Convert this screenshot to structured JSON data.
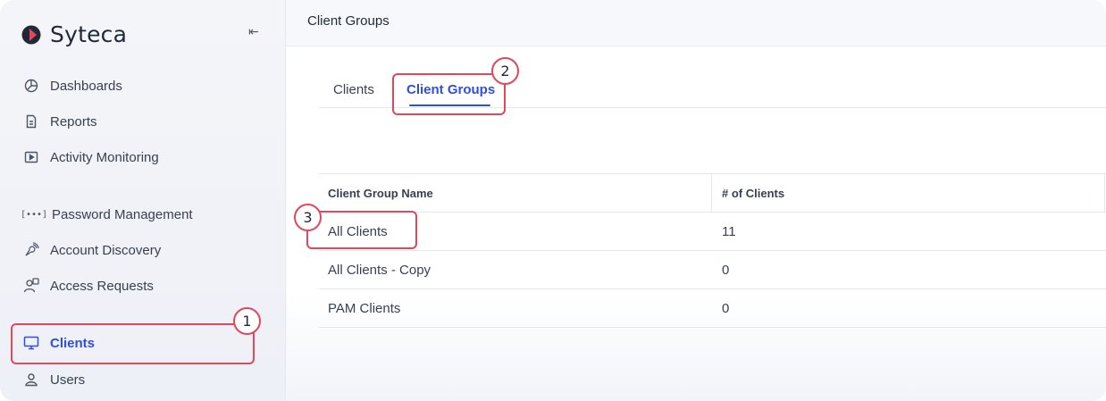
{
  "brand": {
    "name": "Syteca",
    "accent": "#e0485c"
  },
  "sidebar": {
    "collapse_icon": "⇤",
    "items": [
      {
        "label": "Dashboards",
        "icon": "dashboard-icon"
      },
      {
        "label": "Reports",
        "icon": "report-icon"
      },
      {
        "label": "Activity Monitoring",
        "icon": "play-icon"
      },
      {
        "label": "Password Management",
        "icon": "password-icon"
      },
      {
        "label": "Account Discovery",
        "icon": "discovery-icon"
      },
      {
        "label": "Access Requests",
        "icon": "access-request-icon"
      },
      {
        "label": "Clients",
        "icon": "monitor-icon",
        "active": true
      },
      {
        "label": "Users",
        "icon": "user-icon"
      }
    ],
    "password_icon_text": "[•••]"
  },
  "header": {
    "title": "Client Groups"
  },
  "tabs": [
    {
      "label": "Clients"
    },
    {
      "label": "Client Groups",
      "active": true
    }
  ],
  "table": {
    "columns": [
      "Client Group Name",
      "# of Clients"
    ],
    "rows": [
      [
        "All Clients",
        "11"
      ],
      [
        "All Clients - Copy",
        "0"
      ],
      [
        "PAM Clients",
        "0"
      ]
    ]
  },
  "callouts": [
    "1",
    "2",
    "3"
  ],
  "colors": {
    "accent_blue": "#2f4de0",
    "callout_red": "#e0485c"
  }
}
